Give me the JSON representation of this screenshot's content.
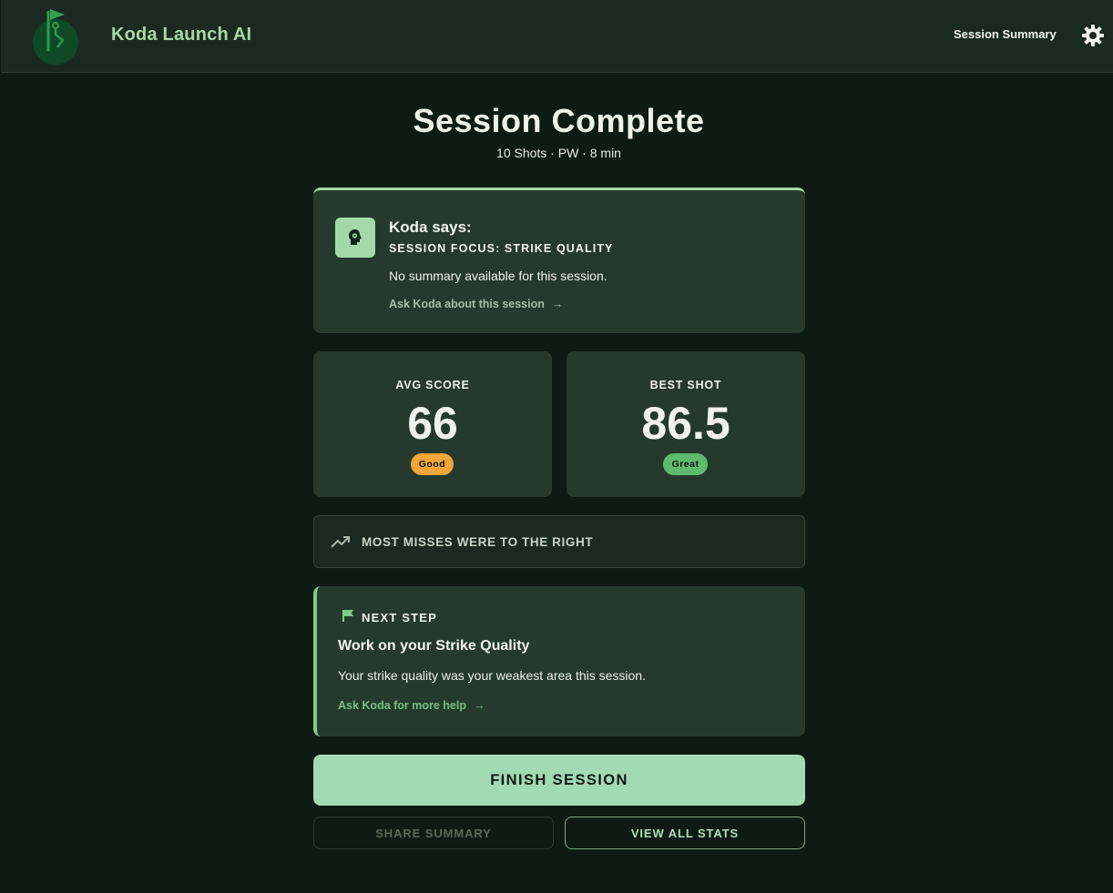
{
  "header": {
    "app_title": "Koda Launch AI",
    "session_link": "Session Summary",
    "logo_icon": "golf-flag-logo-icon",
    "settings_icon": "gear-icon"
  },
  "page": {
    "title": "Session Complete",
    "subtitle": "10 Shots · PW · 8 min"
  },
  "koda": {
    "title": "Koda says:",
    "focus": "SESSION FOCUS: STRIKE QUALITY",
    "summary": "No summary available for this session.",
    "ask_label": "Ask Koda about this session",
    "arrow": "→",
    "avatar_icon": "koda-head-icon"
  },
  "stats": {
    "avg": {
      "label": "AVG SCORE",
      "value": "66",
      "badge": "Good"
    },
    "best": {
      "label": "BEST SHOT",
      "value": "86.5",
      "badge": "Great"
    }
  },
  "miss": {
    "text": "MOST MISSES WERE TO THE RIGHT",
    "icon": "trending-up-icon"
  },
  "next_step": {
    "label": "NEXT STEP",
    "title": "Work on your Strike Quality",
    "description": "Your strike quality was your weakest area this session.",
    "ask_label": "Ask Koda for more help",
    "arrow": "→",
    "icon": "flag-icon"
  },
  "actions": {
    "finish": "FINISH SESSION",
    "share": "SHARE SUMMARY",
    "view_stats": "VIEW ALL STATS"
  },
  "colors": {
    "background": "#0e1b14",
    "header": "#1b2a21",
    "card": "#253a2d",
    "accent": "#a2dab3",
    "good_badge": "#f2a63a",
    "great_badge": "#5fbb6c"
  }
}
